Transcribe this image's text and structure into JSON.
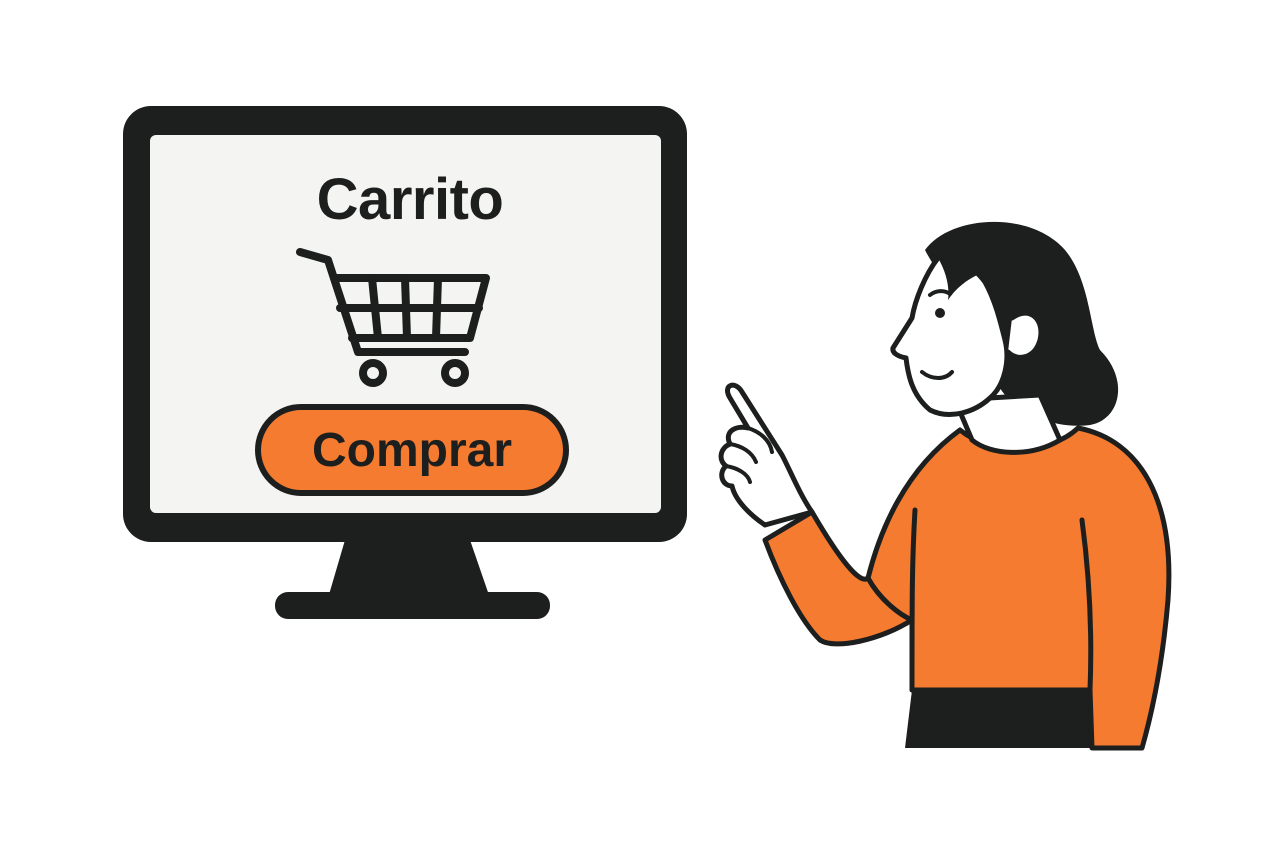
{
  "screen": {
    "title": "Carrito",
    "button_label": "Comprar"
  },
  "icons": {
    "cart": "shopping-cart-icon"
  },
  "colors": {
    "accent": "#f47b30",
    "ink": "#1d1e1e",
    "screen": "#f4f4f3",
    "background": "#ffffff"
  }
}
